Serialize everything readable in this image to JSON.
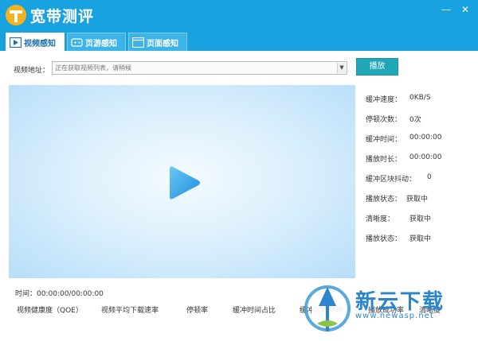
{
  "window": {
    "title": "宽带测评",
    "colors": {
      "titlebar": "#19a2e0",
      "accent": "#1fa7b8"
    },
    "controls": {
      "minimize": "—",
      "close": "✕"
    }
  },
  "tabs": [
    {
      "label": "视频感知",
      "icon": "video-play-icon",
      "active": true
    },
    {
      "label": "页游感知",
      "icon": "gamepad-icon",
      "active": false
    },
    {
      "label": "页面感知",
      "icon": "browser-window-icon",
      "active": false
    }
  ],
  "toolbar": {
    "url_label": "视频地址：",
    "url_value": "正在获取视频列表，请稍候",
    "play_label": "播放"
  },
  "player": {
    "icon": "play-icon"
  },
  "stats": [
    {
      "label": "缓冲速度：",
      "value": "0KB/S"
    },
    {
      "label": "停顿次数：",
      "value": "0次"
    },
    {
      "label": "缓冲时间：",
      "value": "00:00:00"
    },
    {
      "label": "播放时长：",
      "value": "00:00:00"
    },
    {
      "label": "缓冲区块抖动：",
      "value": "0"
    },
    {
      "label": "播放状态：",
      "value": "获取中"
    },
    {
      "label": "清晰度：",
      "value": "获取中"
    },
    {
      "label": "播放状态：",
      "value": "获取中"
    }
  ],
  "time": {
    "label": "时间：",
    "value": "00:00:00/00:00:00"
  },
  "metrics": [
    "视频健康度（QOE）",
    "视频平均下载速率",
    "停顿率",
    "缓冲时间占比",
    "缓冲区块抖动",
    "播放成功率",
    "清晰度"
  ],
  "watermark": {
    "title": "新云下载",
    "url": "www.newasp.net"
  }
}
